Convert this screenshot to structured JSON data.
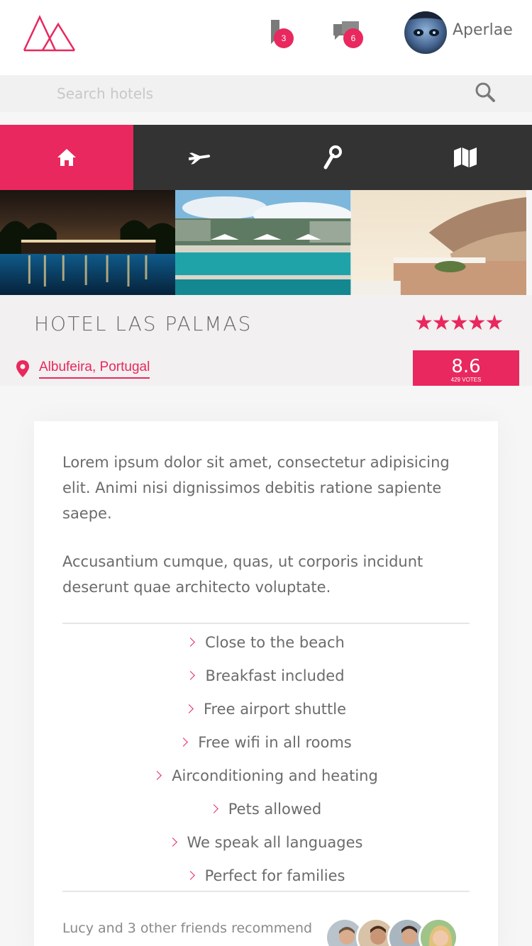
{
  "header": {
    "logo_name": "mountains-logo",
    "bookmarks_count": "3",
    "messages_count": "6",
    "username": "Aperlae"
  },
  "search": {
    "placeholder": "Search hotels",
    "value": ""
  },
  "tabs": [
    {
      "icon": "home-icon",
      "active": true
    },
    {
      "icon": "airplane-icon",
      "active": false
    },
    {
      "icon": "key-icon",
      "active": false
    },
    {
      "icon": "map-icon",
      "active": false
    }
  ],
  "gallery": [
    "night-pool-photo",
    "resort-pool-photo",
    "seaside-terrace-photo"
  ],
  "hotel": {
    "name": "HOTEL LAS PALMAS",
    "stars": "★★★★★",
    "rating_stars": 5,
    "location": "Albufeira, Portugal",
    "score": "8.6",
    "votes": "429 VOTES"
  },
  "description": {
    "p1": "Lorem ipsum dolor sit amet, consectetur adipisicing elit. Animi nisi dignissimos debitis ratione sapiente saepe.",
    "p2": "Accusantium cumque, quas, ut corporis incidunt deserunt quae architecto voluptate."
  },
  "features": [
    "Close to the beach",
    "Breakfast included",
    "Free airport shuttle",
    "Free wifi in all rooms",
    "Airconditioning and heating",
    "Pets allowed",
    "We speak all languages",
    "Perfect for families"
  ],
  "recommend": {
    "text": "Lucy and 3 other friends recommend"
  },
  "colors": {
    "accent": "#e8285e",
    "dark_tab": "#333333",
    "text": "#6b6b6b"
  }
}
